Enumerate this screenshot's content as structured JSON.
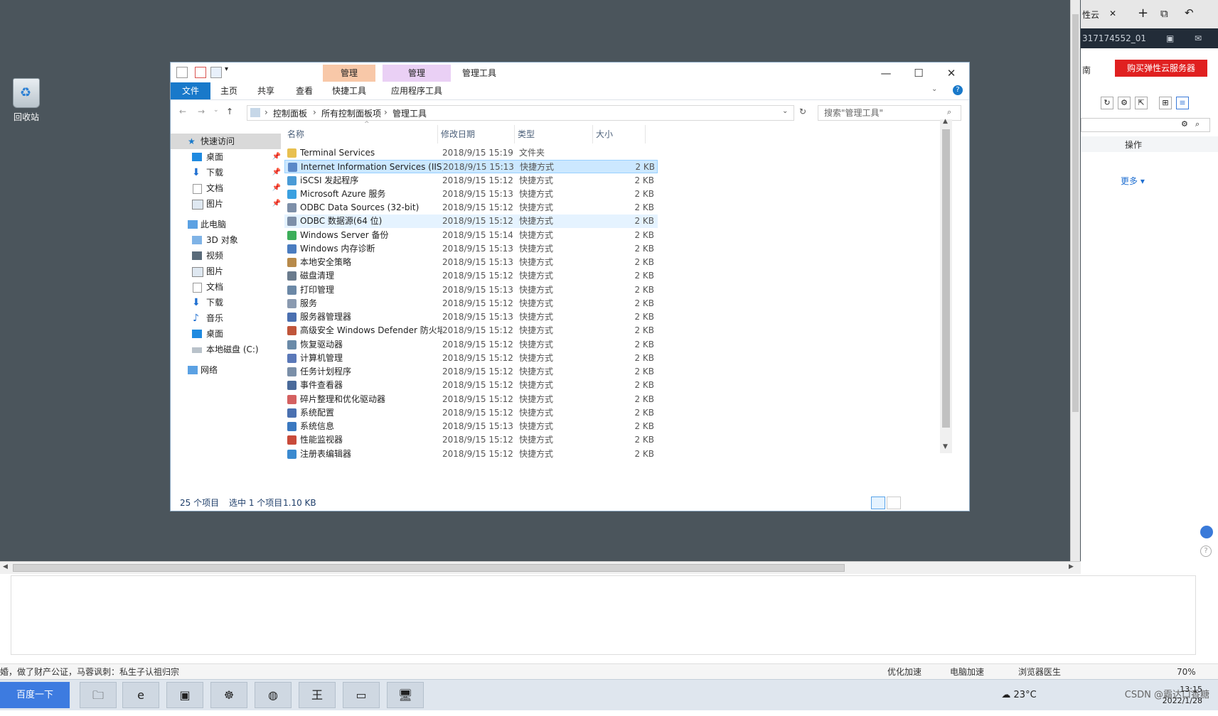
{
  "desktop": {
    "recycle_bin_label": "回收站"
  },
  "explorer": {
    "quick_access_toolbar": [
      "properties-icon",
      "checkmark-icon",
      "new-folder-icon",
      "dropdown-icon"
    ],
    "context_tab_1": "管理",
    "context_tab_2": "管理",
    "title": "管理工具",
    "ribbon_tabs": {
      "file": "文件",
      "home": "主页",
      "share": "共享",
      "view": "查看",
      "shortcut_tools": "快捷工具",
      "app_tools": "应用程序工具"
    },
    "window_buttons": {
      "minimize": "—",
      "maximize": "☐",
      "close": "✕"
    },
    "breadcrumb": [
      "控制面板",
      "所有控制面板项",
      "管理工具"
    ],
    "search_placeholder": "搜索\"管理工具\"",
    "nav": {
      "quick_access": "快速访问",
      "quick_items": [
        "桌面",
        "下载",
        "文档",
        "图片"
      ],
      "this_pc": "此电脑",
      "pc_items": [
        "3D 对象",
        "视频",
        "图片",
        "文档",
        "下载",
        "音乐",
        "桌面",
        "本地磁盘 (C:)"
      ],
      "network": "网络"
    },
    "columns": {
      "name": "名称",
      "date": "修改日期",
      "type": "类型",
      "size": "大小"
    },
    "files": [
      {
        "name": "Terminal Services",
        "date": "2018/9/15 15:19",
        "type": "文件夹",
        "size": "",
        "icon": "folder-icon"
      },
      {
        "name": "Internet Information Services (IIS)管...",
        "date": "2018/9/15 15:13",
        "type": "快捷方式",
        "size": "2 KB",
        "icon": "iis-icon"
      },
      {
        "name": "iSCSI 发起程序",
        "date": "2018/9/15 15:12",
        "type": "快捷方式",
        "size": "2 KB",
        "icon": "iscsi-icon"
      },
      {
        "name": "Microsoft Azure 服务",
        "date": "2018/9/15 15:13",
        "type": "快捷方式",
        "size": "2 KB",
        "icon": "azure-icon"
      },
      {
        "name": "ODBC Data Sources (32-bit)",
        "date": "2018/9/15 15:12",
        "type": "快捷方式",
        "size": "2 KB",
        "icon": "odbc-icon"
      },
      {
        "name": "ODBC 数据源(64 位)",
        "date": "2018/9/15 15:12",
        "type": "快捷方式",
        "size": "2 KB",
        "icon": "odbc-icon"
      },
      {
        "name": "Windows Server 备份",
        "date": "2018/9/15 15:14",
        "type": "快捷方式",
        "size": "2 KB",
        "icon": "backup-icon"
      },
      {
        "name": "Windows 内存诊断",
        "date": "2018/9/15 15:13",
        "type": "快捷方式",
        "size": "2 KB",
        "icon": "memory-icon"
      },
      {
        "name": "本地安全策略",
        "date": "2018/9/15 15:13",
        "type": "快捷方式",
        "size": "2 KB",
        "icon": "security-policy-icon"
      },
      {
        "name": "磁盘清理",
        "date": "2018/9/15 15:12",
        "type": "快捷方式",
        "size": "2 KB",
        "icon": "disk-cleanup-icon"
      },
      {
        "name": "打印管理",
        "date": "2018/9/15 15:13",
        "type": "快捷方式",
        "size": "2 KB",
        "icon": "printer-icon"
      },
      {
        "name": "服务",
        "date": "2018/9/15 15:12",
        "type": "快捷方式",
        "size": "2 KB",
        "icon": "services-icon"
      },
      {
        "name": "服务器管理器",
        "date": "2018/9/15 15:13",
        "type": "快捷方式",
        "size": "2 KB",
        "icon": "server-manager-icon"
      },
      {
        "name": "高级安全 Windows Defender 防火墙",
        "date": "2018/9/15 15:12",
        "type": "快捷方式",
        "size": "2 KB",
        "icon": "firewall-icon"
      },
      {
        "name": "恢复驱动器",
        "date": "2018/9/15 15:12",
        "type": "快捷方式",
        "size": "2 KB",
        "icon": "recovery-drive-icon"
      },
      {
        "name": "计算机管理",
        "date": "2018/9/15 15:12",
        "type": "快捷方式",
        "size": "2 KB",
        "icon": "computer-management-icon"
      },
      {
        "name": "任务计划程序",
        "date": "2018/9/15 15:12",
        "type": "快捷方式",
        "size": "2 KB",
        "icon": "task-scheduler-icon"
      },
      {
        "name": "事件查看器",
        "date": "2018/9/15 15:12",
        "type": "快捷方式",
        "size": "2 KB",
        "icon": "event-viewer-icon"
      },
      {
        "name": "碎片整理和优化驱动器",
        "date": "2018/9/15 15:12",
        "type": "快捷方式",
        "size": "2 KB",
        "icon": "defrag-icon"
      },
      {
        "name": "系统配置",
        "date": "2018/9/15 15:12",
        "type": "快捷方式",
        "size": "2 KB",
        "icon": "system-config-icon"
      },
      {
        "name": "系统信息",
        "date": "2018/9/15 15:13",
        "type": "快捷方式",
        "size": "2 KB",
        "icon": "system-info-icon"
      },
      {
        "name": "性能监视器",
        "date": "2018/9/15 15:12",
        "type": "快捷方式",
        "size": "2 KB",
        "icon": "performance-monitor-icon"
      },
      {
        "name": "注册表编辑器",
        "date": "2018/9/15 15:12",
        "type": "快捷方式",
        "size": "2 KB",
        "icon": "registry-editor-icon"
      }
    ],
    "status": {
      "count": "25 个项目",
      "selected": "选中 1 个项目",
      "selected_size": "1.10 KB"
    }
  },
  "right_panel": {
    "tab_text": "性云",
    "instance_id": "317174552_01",
    "region_text": "南",
    "buy_button": "购买弹性云服务器",
    "column_action": "操作",
    "more_link": "更多 ▾"
  },
  "browser_status": {
    "news": "婚，做了财产公证，马蓉讽刺：私生子认祖归宗",
    "optimize": "优化加速",
    "pc_speed": "电脑加速",
    "doctor": "浏览器医生",
    "zoom": "70%"
  },
  "taskbar": {
    "baidu_button": "百度一下",
    "weather": "23°C",
    "watermark": "CSDN @霸达口香糖",
    "time": "13:15",
    "date": "2022/1/28"
  }
}
